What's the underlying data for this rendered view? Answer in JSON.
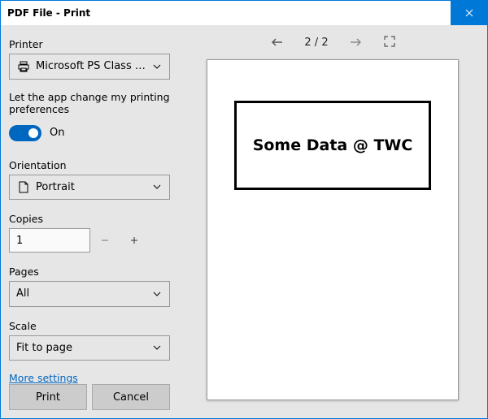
{
  "window": {
    "title": "PDF File - Print"
  },
  "printer": {
    "label": "Printer",
    "selected": "Microsoft PS Class Driver"
  },
  "preferences": {
    "label": "Let the app change my printing preferences",
    "state_text": "On"
  },
  "orientation": {
    "label": "Orientation",
    "selected": "Portrait"
  },
  "copies": {
    "label": "Copies",
    "value": "1"
  },
  "pages": {
    "label": "Pages",
    "selected": "All"
  },
  "scale": {
    "label": "Scale",
    "selected": "Fit to page"
  },
  "more_settings": "More settings",
  "buttons": {
    "print": "Print",
    "cancel": "Cancel"
  },
  "preview": {
    "page_indicator": "2 / 2",
    "content_text": "Some Data @ TWC"
  }
}
